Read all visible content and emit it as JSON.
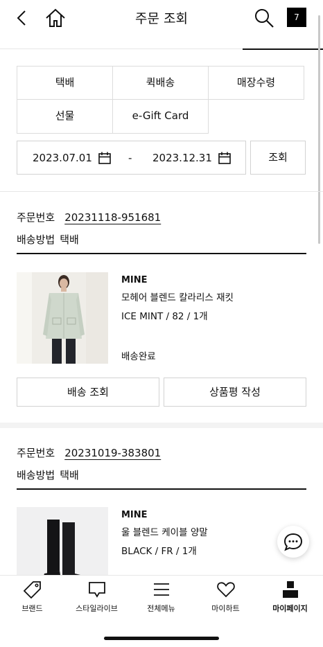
{
  "header": {
    "title": "주문 조회",
    "cart_count": "7",
    "back_icon": "chevron-left-icon",
    "home_icon": "home-icon",
    "search_icon": "search-icon"
  },
  "filters": {
    "types": [
      "택배",
      "퀵배송",
      "매장수령",
      "선물",
      "e-Gift Card"
    ],
    "date_start": "2023.07.01",
    "date_separator": "-",
    "date_end": "2023.12.31",
    "search_label": "조회"
  },
  "orders": [
    {
      "order_label": "주문번호",
      "order_number": "20231118-951681",
      "method_label": "배송방법",
      "method": "택배",
      "product": {
        "brand": "MINE",
        "name": "모헤어 블렌드 칼라리스 재킷",
        "option": "ICE MINT / 82 / 1개",
        "status": "배송완료"
      },
      "actions": [
        "배송 조회",
        "상품평 작성"
      ]
    },
    {
      "order_label": "주문번호",
      "order_number": "20231019-383801",
      "method_label": "배송방법",
      "method": "택배",
      "product": {
        "brand": "MINE",
        "name": "울 블렌드 케이블 양말",
        "option": "BLACK / FR / 1개"
      }
    }
  ],
  "tabbar": [
    {
      "label": "브랜드",
      "icon": "tag-icon"
    },
    {
      "label": "스타일라이브",
      "icon": "live-chat-icon"
    },
    {
      "label": "전체메뉴",
      "icon": "menu-icon"
    },
    {
      "label": "마이하트",
      "icon": "heart-icon"
    },
    {
      "label": "마이페이지",
      "icon": "person-icon",
      "active": true
    }
  ],
  "colors": {
    "text": "#111111",
    "border": "#d2d2d2",
    "divider": "#e6e6e6"
  }
}
